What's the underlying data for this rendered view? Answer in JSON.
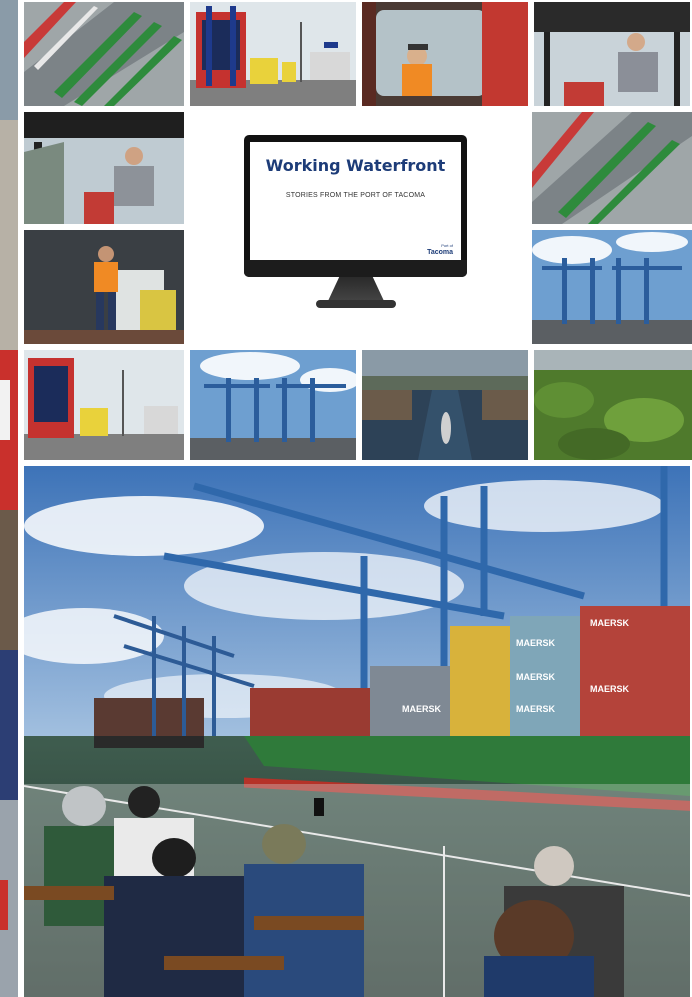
{
  "monitor": {
    "title": "Working Waterfront",
    "subtitle": "STORIES FROM THE PORT OF TACOMA",
    "logo_small": "Port of",
    "logo_name": "Tacoma"
  },
  "ship": {
    "container_labels": [
      "MAERSK",
      "MAERSK",
      "MAERSK",
      "MAERSK",
      "MAERSK",
      "MAERSK"
    ]
  },
  "icons": {
    "logo": "port-logo-icon"
  }
}
